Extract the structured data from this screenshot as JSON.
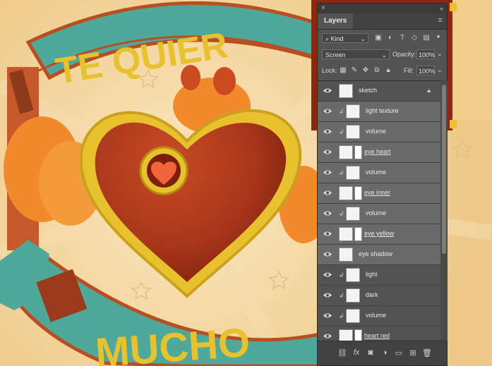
{
  "artwork": {
    "top_text": "TE QUIER",
    "bottom_text": "MUCHO",
    "colors": {
      "teal": "#4fa89a",
      "yellow": "#e8c22e",
      "red": "#b83a1a",
      "orange": "#f08a2c",
      "cream": "#f3d49a"
    }
  },
  "panel": {
    "close_icon": "close-x",
    "collapse_icon": "double-arrow",
    "tab_label": "Layers",
    "menu_icon": "hamburger-menu",
    "filter": {
      "kind_label": "Kind",
      "search_icon": "search"
    },
    "blend_mode": "Screen",
    "opacity_label": "Opacity:",
    "opacity_value": "100%",
    "lock_label": "Lock:",
    "fill_label": "Fill:",
    "fill_value": "100%",
    "layers": [
      {
        "name": "sketch",
        "selected": false,
        "clipped": false,
        "mask": false,
        "underline": false,
        "locked": true
      },
      {
        "name": "light texture",
        "selected": true,
        "clipped": true,
        "mask": false,
        "underline": false
      },
      {
        "name": "volume",
        "selected": true,
        "clipped": true,
        "mask": false,
        "underline": false
      },
      {
        "name": "eye heart",
        "selected": true,
        "clipped": false,
        "mask": true,
        "underline": true
      },
      {
        "name": "volume",
        "selected": true,
        "clipped": true,
        "mask": false,
        "underline": false
      },
      {
        "name": "eye inner",
        "selected": true,
        "clipped": false,
        "mask": true,
        "underline": true
      },
      {
        "name": "volume",
        "selected": true,
        "clipped": true,
        "mask": false,
        "underline": false
      },
      {
        "name": "eye yellow",
        "selected": true,
        "clipped": false,
        "mask": true,
        "underline": true
      },
      {
        "name": "eye shadow",
        "selected": true,
        "clipped": false,
        "mask": false,
        "underline": false
      },
      {
        "name": "light",
        "selected": false,
        "clipped": true,
        "mask": false,
        "underline": false
      },
      {
        "name": "dark",
        "selected": false,
        "clipped": true,
        "mask": false,
        "underline": false
      },
      {
        "name": "volume",
        "selected": false,
        "clipped": true,
        "mask": false,
        "underline": false
      },
      {
        "name": "heart red",
        "selected": false,
        "clipped": false,
        "mask": true,
        "underline": true
      }
    ],
    "bottom_icons": [
      "link-icon",
      "fx-icon",
      "mask-icon",
      "adjustment-icon",
      "folder-icon",
      "new-layer-icon",
      "trash-icon"
    ]
  }
}
